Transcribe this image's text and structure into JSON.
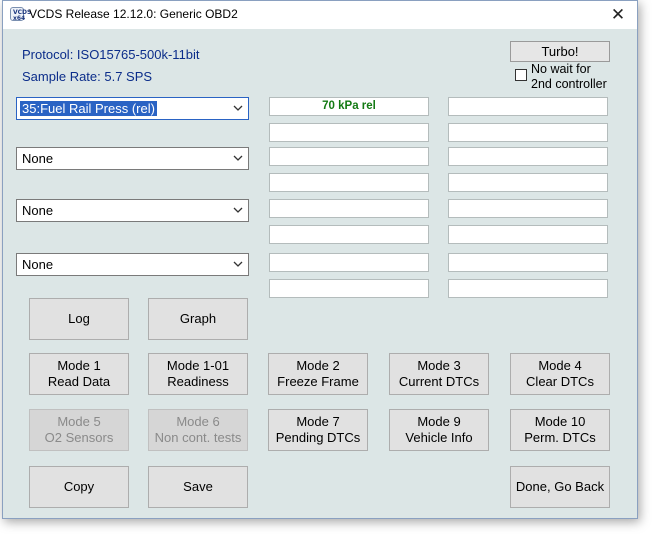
{
  "window": {
    "title": "VCDS Release 12.12.0:  Generic OBD2",
    "close_glyph": "✕",
    "icon_text": "VCDS x64"
  },
  "info": {
    "protocol": "Protocol: ISO15765-500k-11bit",
    "sample_rate": "Sample Rate: 5.7 SPS"
  },
  "turbo": {
    "label": "Turbo!"
  },
  "no_wait": {
    "label_line1": "No wait for",
    "label_line2": "2nd controller",
    "checked": false
  },
  "selectors": [
    {
      "value": "35:Fuel Rail Press (rel)",
      "selected": true
    },
    {
      "value": "None",
      "selected": false
    },
    {
      "value": "None",
      "selected": false
    },
    {
      "value": "None",
      "selected": false
    }
  ],
  "fields": {
    "col1": [
      "70 kPa rel",
      "",
      "",
      "",
      "",
      "",
      "",
      ""
    ],
    "col2": [
      "",
      "",
      "",
      "",
      "",
      "",
      "",
      ""
    ]
  },
  "buttons": {
    "log": "Log",
    "graph": "Graph",
    "mode1": [
      "Mode 1",
      "Read Data"
    ],
    "mode101": [
      "Mode 1-01",
      "Readiness"
    ],
    "mode2": [
      "Mode 2",
      "Freeze Frame"
    ],
    "mode3": [
      "Mode 3",
      "Current DTCs"
    ],
    "mode4": [
      "Mode 4",
      "Clear DTCs"
    ],
    "mode5": [
      "Mode 5",
      "O2 Sensors"
    ],
    "mode6": [
      "Mode 6",
      "Non cont. tests"
    ],
    "mode7": [
      "Mode 7",
      "Pending DTCs"
    ],
    "mode9": [
      "Mode 9",
      "Vehicle Info"
    ],
    "mode10": [
      "Mode 10",
      "Perm. DTCs"
    ],
    "copy": "Copy",
    "save": "Save",
    "done": "Done, Go Back"
  }
}
